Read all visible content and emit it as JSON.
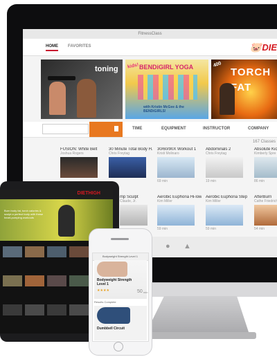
{
  "window_title": "FitnessClass",
  "nav": {
    "home": "HOME",
    "favorites": "FAVORITES",
    "logo": "DIE"
  },
  "banners": [
    {
      "label": "toning"
    },
    {
      "label": "BENDiGIRL YOGA",
      "kids": "kids!",
      "subtitle": "with Kristin McGee & the BENDiGIRLS!"
    },
    {
      "label": "TORCH FAT",
      "tag": "400"
    }
  ],
  "filters": {
    "time": "TIME",
    "equipment": "EQUIPMENT",
    "instructor": "INSTRUCTOR",
    "company": "COMPANY"
  },
  "class_count": "167 Classes",
  "classes_row1": [
    {
      "title": "FUSION: White Belt",
      "instructor": "Joshua Rogers"
    },
    {
      "title": "30 Minute Total Body H...",
      "instructor": "Chris Freytag"
    },
    {
      "title": "30/60/90X Workout 1",
      "instructor": "Kristi Molinaro",
      "duration": "69 min"
    },
    {
      "title": "Abdominals 2",
      "instructor": "Chris Freytag",
      "duration": "19 min"
    },
    {
      "title": "Absolute Kickbox",
      "instructor": "Kimberly Spre",
      "duration": "86 min"
    }
  ],
  "classes_row2": [
    {
      "title": "mp Sculpt",
      "instructor": "Claude, Jr."
    },
    {
      "title": "Aerobic Euphoria Hi-low",
      "instructor": "Kim Miller",
      "duration": "59 min"
    },
    {
      "title": "Aerobic Euphoria Step",
      "instructor": "Kim Miller",
      "duration": "59 min"
    },
    {
      "title": "AfterBurn",
      "instructor": "Cathe Friedrich",
      "duration": "54 min"
    }
  ],
  "colors": {
    "accent": "#d41920",
    "search_button": "#e87820"
  },
  "ipad": {
    "logo": "DIETHIGH",
    "hero_text": "Burn body fat, torch calories & sculpt a perfect body with these heart-pumping workouts"
  },
  "iphone": {
    "header": "Bodyweight Strength Level 1",
    "card1_title": "Bodyweight Strength Level 1",
    "card1_duration": "50",
    "card1_unit": "min",
    "section": "Results Complete",
    "card2_title": "Dumbbell Circuit"
  }
}
